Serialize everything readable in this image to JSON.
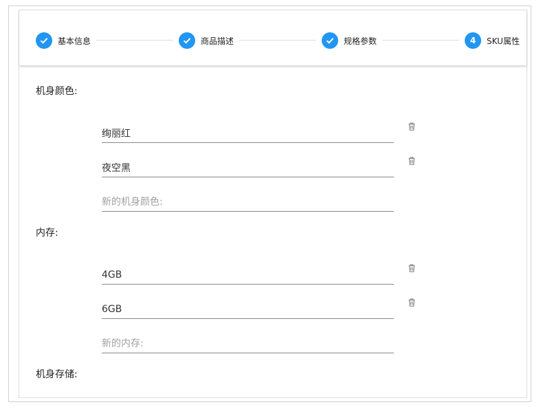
{
  "stepper": {
    "steps": [
      {
        "label": "基本信息",
        "status": "completed",
        "number": "1"
      },
      {
        "label": "商品描述",
        "status": "completed",
        "number": "2"
      },
      {
        "label": "规格参数",
        "status": "completed",
        "number": "3"
      },
      {
        "label": "SKU属性",
        "status": "active",
        "number": "4"
      }
    ],
    "accent_color": "#2196f3"
  },
  "sku": {
    "groups": [
      {
        "label": "机身颜色:",
        "values": [
          "绚丽红",
          "夜空黑"
        ],
        "new_placeholder": "新的机身颜色:"
      },
      {
        "label": "内存:",
        "values": [
          "4GB",
          "6GB"
        ],
        "new_placeholder": "新的内存:"
      },
      {
        "label": "机身存储:"
      }
    ]
  }
}
